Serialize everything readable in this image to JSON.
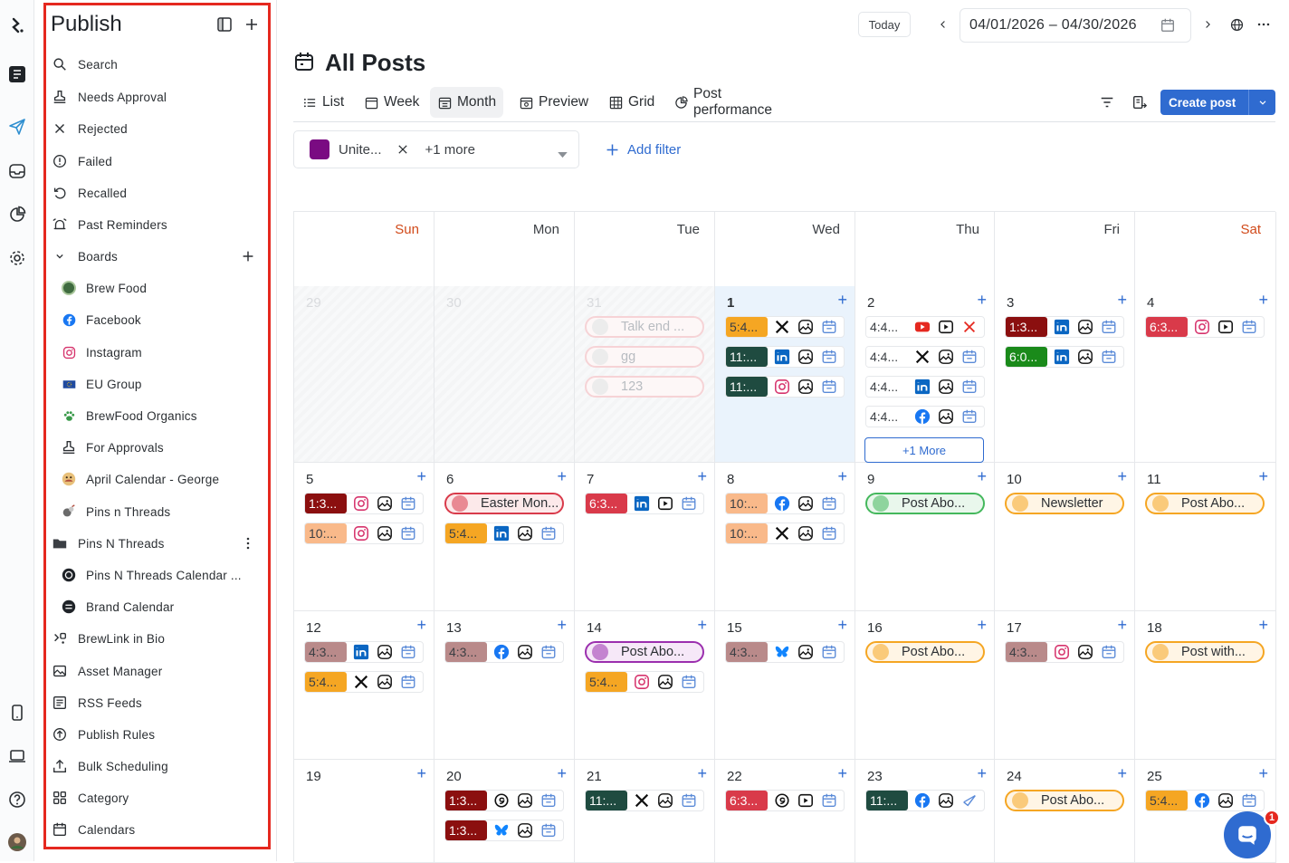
{
  "sidebar": {
    "title": "Publish",
    "items": [
      {
        "label": "Search",
        "icon": "search-icon"
      },
      {
        "label": "Needs Approval",
        "icon": "stamp-icon"
      },
      {
        "label": "Rejected",
        "icon": "x-icon"
      },
      {
        "label": "Failed",
        "icon": "alert-circle-icon"
      },
      {
        "label": "Recalled",
        "icon": "undo-icon"
      },
      {
        "label": "Past Reminders",
        "icon": "alarm-icon"
      },
      {
        "label": "Boards",
        "icon": "chevron-down-icon"
      },
      {
        "label": "Brew Food",
        "icon": "brew-food-avatar"
      },
      {
        "label": "Facebook",
        "icon": "facebook-icon"
      },
      {
        "label": "Instagram",
        "icon": "instagram-icon"
      },
      {
        "label": "EU Group",
        "icon": "eu-flag-icon"
      },
      {
        "label": "BrewFood Organics",
        "icon": "paw-icon"
      },
      {
        "label": "For Approvals",
        "icon": "stamp-icon"
      },
      {
        "label": "April Calendar - George",
        "icon": "april-avatar"
      },
      {
        "label": "Pins n Threads",
        "icon": "pins-avatar"
      },
      {
        "label": "Pins N Threads",
        "icon": "folder-icon"
      },
      {
        "label": "Pins N Threads Calendar ...",
        "icon": "pins-calendar-avatar"
      },
      {
        "label": "Brand Calendar",
        "icon": "brand-calendar-avatar"
      },
      {
        "label": "BrewLink in Bio",
        "icon": "link-icon"
      },
      {
        "label": "Asset Manager",
        "icon": "image-icon"
      },
      {
        "label": "RSS Feeds",
        "icon": "rss-icon"
      },
      {
        "label": "Publish Rules",
        "icon": "rules-icon"
      },
      {
        "label": "Bulk Scheduling",
        "icon": "upload-icon"
      },
      {
        "label": "Category",
        "icon": "grid-icon"
      },
      {
        "label": "Calendars",
        "icon": "calendar-icon"
      }
    ]
  },
  "topbar": {
    "today": "Today",
    "date_range": "04/01/2026  – 04/30/2026"
  },
  "page": {
    "title": "All Posts",
    "tabs": [
      "List",
      "Week",
      "Month",
      "Preview",
      "Grid",
      "Post performance"
    ],
    "active_tab": "Month",
    "create_post": "Create post"
  },
  "filters": {
    "chip_label": "Unite...",
    "chip_color": "#7a0b82",
    "more": "+1 more",
    "add_filter": "Add filter"
  },
  "calendar": {
    "weekdays": [
      "Sun",
      "Mon",
      "Tue",
      "Wed",
      "Thu",
      "Fri",
      "Sat"
    ],
    "more_label": "+1 More",
    "days": [
      {
        "n": "29",
        "prev": true,
        "posts": []
      },
      {
        "n": "30",
        "prev": true,
        "posts": []
      },
      {
        "n": "31",
        "prev": true,
        "pills": [
          {
            "text": "Talk end ...",
            "faded": true
          },
          {
            "text": "gg",
            "faded": true
          },
          {
            "text": "123",
            "faded": true
          }
        ]
      },
      {
        "n": "1",
        "today": true,
        "posts": [
          {
            "t": "5:4...",
            "c": "#f5a623",
            "icons": [
              "x",
              "img",
              "cal"
            ]
          },
          {
            "t": "11:...",
            "c": "#1f4b40",
            "icons": [
              "in",
              "img",
              "cal"
            ]
          },
          {
            "t": "11:...",
            "c": "#1f4b40",
            "icons": [
              "ig",
              "img",
              "cal"
            ]
          }
        ]
      },
      {
        "n": "2",
        "posts": [
          {
            "t": "4:4...",
            "c": "#ffffff",
            "icons": [
              "yt",
              "play",
              "xred"
            ]
          },
          {
            "t": "4:4...",
            "c": "#ffffff",
            "icons": [
              "x",
              "img",
              "cal"
            ]
          },
          {
            "t": "4:4...",
            "c": "#ffffff",
            "icons": [
              "in",
              "img",
              "cal"
            ]
          },
          {
            "t": "4:4...",
            "c": "#ffffff",
            "icons": [
              "fb",
              "img",
              "cal"
            ]
          }
        ],
        "more": true
      },
      {
        "n": "3",
        "posts": [
          {
            "t": "1:3...",
            "c": "#8b0f0f",
            "icons": [
              "in",
              "img",
              "cal"
            ]
          },
          {
            "t": "6:0...",
            "c": "#1a8a1a",
            "icons": [
              "in",
              "img",
              "cal"
            ]
          }
        ]
      },
      {
        "n": "4",
        "posts": [
          {
            "t": "6:3...",
            "c": "#d93a4a",
            "icons": [
              "ig",
              "play",
              "cal"
            ]
          }
        ]
      },
      {
        "n": "5",
        "posts": [
          {
            "t": "1:3...",
            "c": "#8b0f0f",
            "icons": [
              "ig",
              "img",
              "cal"
            ]
          },
          {
            "t": "10:...",
            "c": "#f9b98a",
            "icons": [
              "ig",
              "img",
              "cal"
            ]
          }
        ]
      },
      {
        "n": "6",
        "pills": [
          {
            "text": "Easter Mon...",
            "border": "#d93a4a",
            "bg": "#fce9ea"
          }
        ],
        "posts2": [
          {
            "t": "5:4...",
            "c": "#f5a623",
            "icons": [
              "in",
              "img",
              "cal"
            ]
          }
        ]
      },
      {
        "n": "7",
        "posts": [
          {
            "t": "6:3...",
            "c": "#d93a4a",
            "icons": [
              "in",
              "play",
              "cal"
            ]
          }
        ]
      },
      {
        "n": "8",
        "posts": [
          {
            "t": "10:...",
            "c": "#f9b98a",
            "icons": [
              "fb",
              "img",
              "cal"
            ]
          },
          {
            "t": "10:...",
            "c": "#f9b98a",
            "icons": [
              "x",
              "img",
              "cal"
            ]
          }
        ]
      },
      {
        "n": "9",
        "pills": [
          {
            "text": "Post Abo...",
            "border": "#44b85c",
            "bg": "#e9f7ec"
          }
        ]
      },
      {
        "n": "10",
        "pills": [
          {
            "text": "Newsletter",
            "border": "#f5a623",
            "bg": "#fff5e5"
          }
        ]
      },
      {
        "n": "11",
        "pills": [
          {
            "text": "Post Abo...",
            "border": "#f5a623",
            "bg": "#fff5e5"
          }
        ]
      },
      {
        "n": "12",
        "posts": [
          {
            "t": "4:3...",
            "c": "#b98a8a",
            "icons": [
              "in",
              "img",
              "cal"
            ]
          },
          {
            "t": "5:4...",
            "c": "#f5a623",
            "icons": [
              "x",
              "img",
              "cal"
            ]
          }
        ]
      },
      {
        "n": "13",
        "posts": [
          {
            "t": "4:3...",
            "c": "#b98a8a",
            "icons": [
              "fb",
              "img",
              "cal"
            ]
          }
        ]
      },
      {
        "n": "14",
        "pills": [
          {
            "text": "Post Abo...",
            "border": "#9b2fae",
            "bg": "#f6e8f8"
          }
        ],
        "posts2": [
          {
            "t": "5:4...",
            "c": "#f5a623",
            "icons": [
              "ig",
              "img",
              "cal"
            ]
          }
        ]
      },
      {
        "n": "15",
        "posts": [
          {
            "t": "4:3...",
            "c": "#b98a8a",
            "icons": [
              "bsky",
              "img",
              "cal"
            ]
          }
        ]
      },
      {
        "n": "16",
        "pills": [
          {
            "text": "Post Abo...",
            "border": "#f5a623",
            "bg": "#fff5e5"
          }
        ]
      },
      {
        "n": "17",
        "posts": [
          {
            "t": "4:3...",
            "c": "#b98a8a",
            "icons": [
              "ig",
              "img",
              "cal"
            ]
          }
        ]
      },
      {
        "n": "18",
        "pills": [
          {
            "text": "Post with...",
            "border": "#f5a623",
            "bg": "#fff5e5"
          }
        ]
      },
      {
        "n": "19",
        "posts": []
      },
      {
        "n": "20",
        "posts": [
          {
            "t": "1:3...",
            "c": "#8b0f0f",
            "icons": [
              "threads",
              "img",
              "cal"
            ]
          },
          {
            "t": "1:3...",
            "c": "#8b0f0f",
            "icons": [
              "bsky",
              "img",
              "cal"
            ]
          }
        ]
      },
      {
        "n": "21",
        "posts": [
          {
            "t": "11:...",
            "c": "#1f4b40",
            "icons": [
              "x",
              "img",
              "cal"
            ]
          }
        ]
      },
      {
        "n": "22",
        "posts": [
          {
            "t": "6:3...",
            "c": "#d93a4a",
            "icons": [
              "threads",
              "play",
              "cal"
            ]
          }
        ]
      },
      {
        "n": "23",
        "posts": [
          {
            "t": "11:...",
            "c": "#1f4b40",
            "icons": [
              "fb",
              "img",
              "send"
            ]
          }
        ]
      },
      {
        "n": "24",
        "pills": [
          {
            "text": "Post Abo...",
            "border": "#f5a623",
            "bg": "#fff5e5"
          }
        ]
      },
      {
        "n": "25",
        "posts": [
          {
            "t": "5:4...",
            "c": "#f5a623",
            "icons": [
              "fb",
              "img",
              "cal"
            ]
          }
        ]
      }
    ]
  },
  "chat": {
    "badge": "1"
  }
}
